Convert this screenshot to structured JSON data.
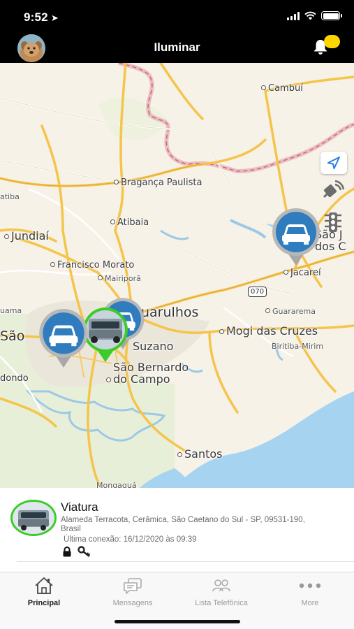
{
  "status_bar": {
    "time": "9:52",
    "location_icon": "location-arrow-icon",
    "wifi_icon": "wifi-icon",
    "battery_icon": "battery-icon"
  },
  "header": {
    "title": "Iluminar",
    "avatar_icon": "dog-avatar",
    "bell_icon": "bell-icon",
    "badge_color": "#ffd500"
  },
  "map": {
    "labels": {
      "cambui": "Cambuí",
      "atibaia_partial": "atiba",
      "braganca": "Bragança Paulista",
      "atibaia": "Atibaia",
      "jundiai": "Jundiaí",
      "sao_jose": "São J",
      "sao_jose2": "dos C",
      "francisco_morato": "Francisco Morato",
      "mairipora": "Mairiporã",
      "jacarei": "Jacareí",
      "guarulhos": "uarulhos",
      "guarema": "Guararema",
      "uama": "uama",
      "sao": "São",
      "mogi": "Mogi das Cruzes",
      "suzano": "Suzano",
      "biritiba": "Biritiba-Mirim",
      "dondo": "dondo",
      "sbc1": "São Bernardo",
      "sbc2": "do Campo",
      "santos": "Santos",
      "mongagua": "Mongaguá",
      "highway_070": "070"
    },
    "controls": {
      "locate_icon": "location-arrow-icon",
      "signal_icon": "signal-icon",
      "traffic_icon": "traffic-light-icon"
    },
    "pins": [
      {
        "name": "vehicle-pin",
        "kind": "car-icon",
        "color": "#2f7dbf"
      },
      {
        "name": "vehicle-pin",
        "kind": "car-icon",
        "color": "#2f7dbf"
      },
      {
        "name": "vehicle-pin",
        "kind": "car-icon",
        "color": "#2f7dbf"
      },
      {
        "name": "selected-vehicle-pin",
        "kind": "vehicle-photo",
        "color": "#3bcc2a"
      }
    ]
  },
  "vehicle": {
    "title": "Viatura",
    "address": "Alameda Terracota, Cerâmica, São Caetano do Sul - SP, 09531-190, Brasil",
    "last_connection": "Última conexão: 16/12/2020 às 09:39",
    "status_icons": [
      "lock-icon",
      "key-icon"
    ]
  },
  "tabs": [
    {
      "label": "Principal",
      "icon": "home-icon",
      "active": true
    },
    {
      "label": "Mensagens",
      "icon": "messages-icon",
      "active": false
    },
    {
      "label": "Lista Telefônica",
      "icon": "contacts-icon",
      "active": false
    },
    {
      "label": "More",
      "icon": "more-icon",
      "active": false
    }
  ]
}
